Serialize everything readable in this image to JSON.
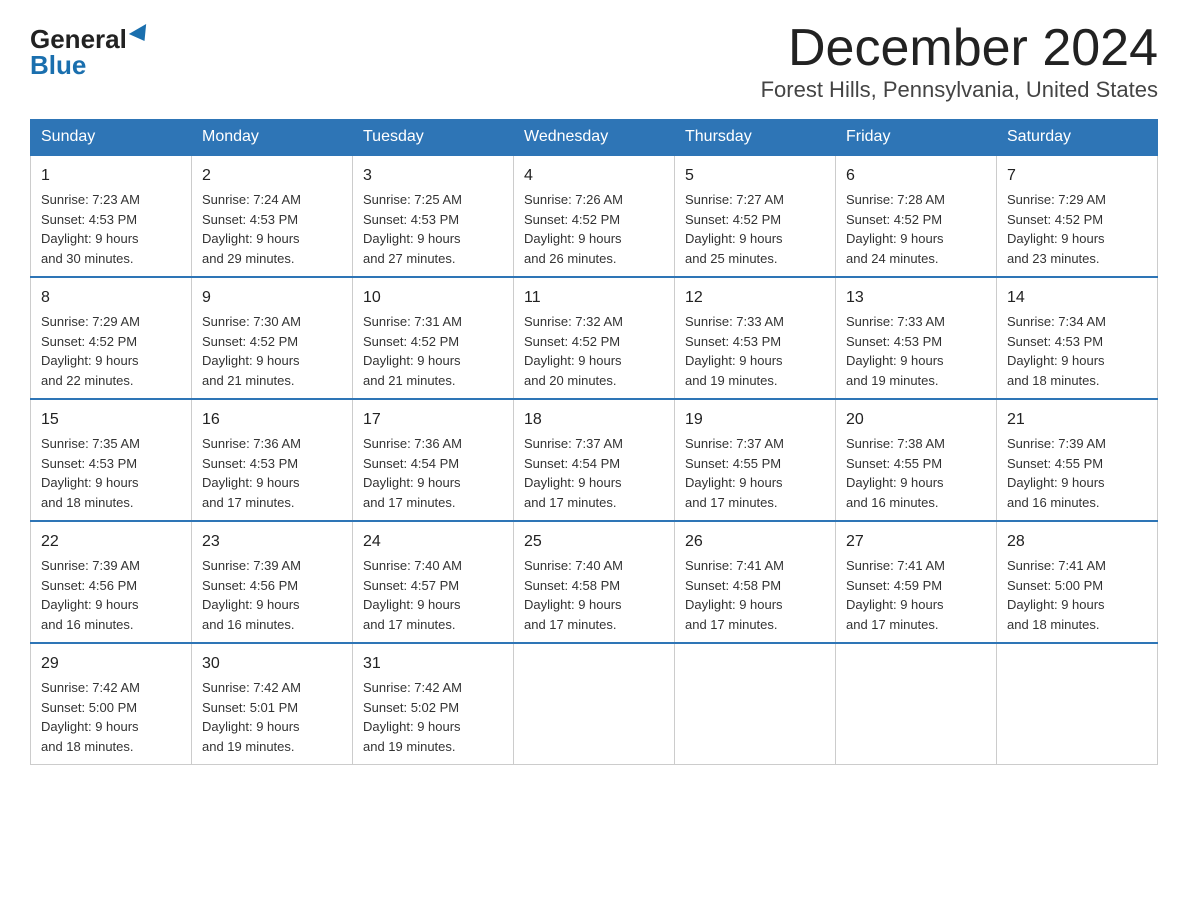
{
  "header": {
    "month_title": "December 2024",
    "location": "Forest Hills, Pennsylvania, United States",
    "logo_general": "General",
    "logo_blue": "Blue"
  },
  "days_of_week": [
    "Sunday",
    "Monday",
    "Tuesday",
    "Wednesday",
    "Thursday",
    "Friday",
    "Saturday"
  ],
  "weeks": [
    [
      {
        "num": "1",
        "sunrise": "7:23 AM",
        "sunset": "4:53 PM",
        "daylight": "9 hours and 30 minutes."
      },
      {
        "num": "2",
        "sunrise": "7:24 AM",
        "sunset": "4:53 PM",
        "daylight": "9 hours and 29 minutes."
      },
      {
        "num": "3",
        "sunrise": "7:25 AM",
        "sunset": "4:53 PM",
        "daylight": "9 hours and 27 minutes."
      },
      {
        "num": "4",
        "sunrise": "7:26 AM",
        "sunset": "4:52 PM",
        "daylight": "9 hours and 26 minutes."
      },
      {
        "num": "5",
        "sunrise": "7:27 AM",
        "sunset": "4:52 PM",
        "daylight": "9 hours and 25 minutes."
      },
      {
        "num": "6",
        "sunrise": "7:28 AM",
        "sunset": "4:52 PM",
        "daylight": "9 hours and 24 minutes."
      },
      {
        "num": "7",
        "sunrise": "7:29 AM",
        "sunset": "4:52 PM",
        "daylight": "9 hours and 23 minutes."
      }
    ],
    [
      {
        "num": "8",
        "sunrise": "7:29 AM",
        "sunset": "4:52 PM",
        "daylight": "9 hours and 22 minutes."
      },
      {
        "num": "9",
        "sunrise": "7:30 AM",
        "sunset": "4:52 PM",
        "daylight": "9 hours and 21 minutes."
      },
      {
        "num": "10",
        "sunrise": "7:31 AM",
        "sunset": "4:52 PM",
        "daylight": "9 hours and 21 minutes."
      },
      {
        "num": "11",
        "sunrise": "7:32 AM",
        "sunset": "4:52 PM",
        "daylight": "9 hours and 20 minutes."
      },
      {
        "num": "12",
        "sunrise": "7:33 AM",
        "sunset": "4:53 PM",
        "daylight": "9 hours and 19 minutes."
      },
      {
        "num": "13",
        "sunrise": "7:33 AM",
        "sunset": "4:53 PM",
        "daylight": "9 hours and 19 minutes."
      },
      {
        "num": "14",
        "sunrise": "7:34 AM",
        "sunset": "4:53 PM",
        "daylight": "9 hours and 18 minutes."
      }
    ],
    [
      {
        "num": "15",
        "sunrise": "7:35 AM",
        "sunset": "4:53 PM",
        "daylight": "9 hours and 18 minutes."
      },
      {
        "num": "16",
        "sunrise": "7:36 AM",
        "sunset": "4:53 PM",
        "daylight": "9 hours and 17 minutes."
      },
      {
        "num": "17",
        "sunrise": "7:36 AM",
        "sunset": "4:54 PM",
        "daylight": "9 hours and 17 minutes."
      },
      {
        "num": "18",
        "sunrise": "7:37 AM",
        "sunset": "4:54 PM",
        "daylight": "9 hours and 17 minutes."
      },
      {
        "num": "19",
        "sunrise": "7:37 AM",
        "sunset": "4:55 PM",
        "daylight": "9 hours and 17 minutes."
      },
      {
        "num": "20",
        "sunrise": "7:38 AM",
        "sunset": "4:55 PM",
        "daylight": "9 hours and 16 minutes."
      },
      {
        "num": "21",
        "sunrise": "7:39 AM",
        "sunset": "4:55 PM",
        "daylight": "9 hours and 16 minutes."
      }
    ],
    [
      {
        "num": "22",
        "sunrise": "7:39 AM",
        "sunset": "4:56 PM",
        "daylight": "9 hours and 16 minutes."
      },
      {
        "num": "23",
        "sunrise": "7:39 AM",
        "sunset": "4:56 PM",
        "daylight": "9 hours and 16 minutes."
      },
      {
        "num": "24",
        "sunrise": "7:40 AM",
        "sunset": "4:57 PM",
        "daylight": "9 hours and 17 minutes."
      },
      {
        "num": "25",
        "sunrise": "7:40 AM",
        "sunset": "4:58 PM",
        "daylight": "9 hours and 17 minutes."
      },
      {
        "num": "26",
        "sunrise": "7:41 AM",
        "sunset": "4:58 PM",
        "daylight": "9 hours and 17 minutes."
      },
      {
        "num": "27",
        "sunrise": "7:41 AM",
        "sunset": "4:59 PM",
        "daylight": "9 hours and 17 minutes."
      },
      {
        "num": "28",
        "sunrise": "7:41 AM",
        "sunset": "5:00 PM",
        "daylight": "9 hours and 18 minutes."
      }
    ],
    [
      {
        "num": "29",
        "sunrise": "7:42 AM",
        "sunset": "5:00 PM",
        "daylight": "9 hours and 18 minutes."
      },
      {
        "num": "30",
        "sunrise": "7:42 AM",
        "sunset": "5:01 PM",
        "daylight": "9 hours and 19 minutes."
      },
      {
        "num": "31",
        "sunrise": "7:42 AM",
        "sunset": "5:02 PM",
        "daylight": "9 hours and 19 minutes."
      },
      null,
      null,
      null,
      null
    ]
  ]
}
